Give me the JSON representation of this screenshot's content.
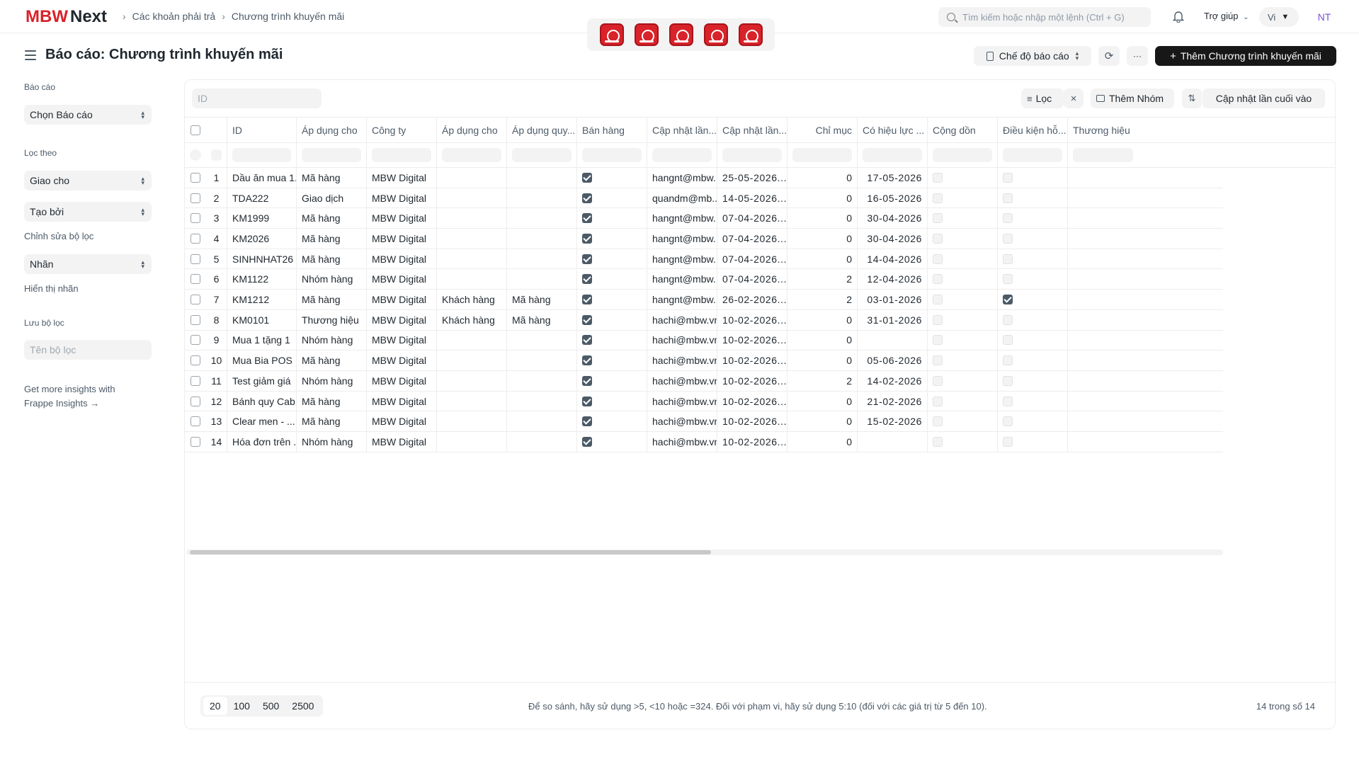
{
  "navbar": {
    "logo_mbw": "MBW",
    "logo_next": "Next",
    "breadcrumb": [
      "Các khoản phải trả",
      "Chương trình khuyến mãi"
    ],
    "search_placeholder": "Tìm kiếm hoặc nhập một lệnh (Ctrl + G)",
    "help_label": "Trợ giúp",
    "lang_label": "Vi",
    "avatar_initials": "NT",
    "app_icons": [
      "app-shortcut-1",
      "app-shortcut-2",
      "app-shortcut-3",
      "app-shortcut-4",
      "app-shortcut-5"
    ]
  },
  "page": {
    "title": "Báo cáo: Chương trình khuyến mãi",
    "report_mode_label": "Chế độ báo cáo",
    "more_label": "···",
    "add_label": "Thêm Chương trình khuyến mãi"
  },
  "sidebar": {
    "report_label": "Báo cáo",
    "report_select": "Chọn Báo cáo",
    "filter_by_label": "Lọc theo",
    "assigned_to": "Giao cho",
    "created_by": "Tạo bởi",
    "edit_filters": "Chỉnh sửa bộ lọc",
    "tags": "Nhãn",
    "show_tags": "Hiển thị nhãn",
    "save_filter_label": "Lưu bộ lọc",
    "filter_name_placeholder": "Tên bộ lọc",
    "insights_line1": "Get more insights with",
    "insights_line2": "Frappe Insights →"
  },
  "toolbar": {
    "id_placeholder": "ID",
    "filter_label": "Lọc",
    "group_label": "Thêm Nhóm",
    "sort_label": "Cập nhật lần cuối vào"
  },
  "table": {
    "columns": [
      "ID",
      "Áp dụng cho",
      "Công ty",
      "Áp dụng cho",
      "Áp dụng quy...",
      "Bán hàng",
      "Cập nhật lần...",
      "Cập nhật lần...",
      "Chỉ mục",
      "Có hiệu lực ...",
      "Cộng dồn",
      "Điều kiện hỗ...",
      "Thương hiệu"
    ],
    "rows": [
      {
        "n": "1",
        "id": "Dầu ăn mua 1...",
        "apply_on": "Mã hàng",
        "company": "MBW Digital",
        "applicable_for": "",
        "apply_rule": "",
        "selling": true,
        "modified_by": "hangnt@mbw...",
        "modified": "25-05-2026...",
        "idx": "0",
        "valid_upto": "17-05-2026",
        "mixed": false,
        "cond": false
      },
      {
        "n": "2",
        "id": "TDA222",
        "apply_on": "Giao dịch",
        "company": "MBW Digital",
        "applicable_for": "",
        "apply_rule": "",
        "selling": true,
        "modified_by": "quandm@mb...",
        "modified": "14-05-2026...",
        "idx": "0",
        "valid_upto": "16-05-2026",
        "mixed": false,
        "cond": false
      },
      {
        "n": "3",
        "id": "KM1999",
        "apply_on": "Mã hàng",
        "company": "MBW Digital",
        "applicable_for": "",
        "apply_rule": "",
        "selling": true,
        "modified_by": "hangnt@mbw...",
        "modified": "07-04-2026...",
        "idx": "0",
        "valid_upto": "30-04-2026",
        "mixed": false,
        "cond": false
      },
      {
        "n": "4",
        "id": "KM2026",
        "apply_on": "Mã hàng",
        "company": "MBW Digital",
        "applicable_for": "",
        "apply_rule": "",
        "selling": true,
        "modified_by": "hangnt@mbw...",
        "modified": "07-04-2026...",
        "idx": "0",
        "valid_upto": "30-04-2026",
        "mixed": false,
        "cond": false
      },
      {
        "n": "5",
        "id": "SINHNHAT26",
        "apply_on": "Mã hàng",
        "company": "MBW Digital",
        "applicable_for": "",
        "apply_rule": "",
        "selling": true,
        "modified_by": "hangnt@mbw...",
        "modified": "07-04-2026...",
        "idx": "0",
        "valid_upto": "14-04-2026",
        "mixed": false,
        "cond": false
      },
      {
        "n": "6",
        "id": "KM1122",
        "apply_on": "Nhóm hàng",
        "company": "MBW Digital",
        "applicable_for": "",
        "apply_rule": "",
        "selling": true,
        "modified_by": "hangnt@mbw...",
        "modified": "07-04-2026...",
        "idx": "2",
        "valid_upto": "12-04-2026",
        "mixed": false,
        "cond": false
      },
      {
        "n": "7",
        "id": "KM1212",
        "apply_on": "Mã hàng",
        "company": "MBW Digital",
        "applicable_for": "Khách hàng",
        "apply_rule": "Mã hàng",
        "selling": true,
        "modified_by": "hangnt@mbw...",
        "modified": "26-02-2026...",
        "idx": "2",
        "valid_upto": "03-01-2026",
        "mixed": false,
        "cond": true
      },
      {
        "n": "8",
        "id": "KM0101",
        "apply_on": "Thương hiệu",
        "company": "MBW Digital",
        "applicable_for": "Khách hàng",
        "apply_rule": "Mã hàng",
        "selling": true,
        "modified_by": "hachi@mbw.vn",
        "modified": "10-02-2026...",
        "idx": "0",
        "valid_upto": "31-01-2026",
        "mixed": false,
        "cond": false
      },
      {
        "n": "9",
        "id": "Mua 1 tặng 1",
        "apply_on": "Nhóm hàng",
        "company": "MBW Digital",
        "applicable_for": "",
        "apply_rule": "",
        "selling": true,
        "modified_by": "hachi@mbw.vn",
        "modified": "10-02-2026...",
        "idx": "0",
        "valid_upto": "",
        "mixed": false,
        "cond": false
      },
      {
        "n": "10",
        "id": "Mua Bia POS",
        "apply_on": "Mã hàng",
        "company": "MBW Digital",
        "applicable_for": "",
        "apply_rule": "",
        "selling": true,
        "modified_by": "hachi@mbw.vn",
        "modified": "10-02-2026...",
        "idx": "0",
        "valid_upto": "05-06-2026",
        "mixed": false,
        "cond": false
      },
      {
        "n": "11",
        "id": "Test giảm giá",
        "apply_on": "Nhóm hàng",
        "company": "MBW Digital",
        "applicable_for": "",
        "apply_rule": "",
        "selling": true,
        "modified_by": "hachi@mbw.vn",
        "modified": "10-02-2026...",
        "idx": "2",
        "valid_upto": "14-02-2026",
        "mixed": false,
        "cond": false
      },
      {
        "n": "12",
        "id": "Bánh quy Cab...",
        "apply_on": "Mã hàng",
        "company": "MBW Digital",
        "applicable_for": "",
        "apply_rule": "",
        "selling": true,
        "modified_by": "hachi@mbw.vn",
        "modified": "10-02-2026...",
        "idx": "0",
        "valid_upto": "21-02-2026",
        "mixed": false,
        "cond": false
      },
      {
        "n": "13",
        "id": "Clear men - ...",
        "apply_on": "Mã hàng",
        "company": "MBW Digital",
        "applicable_for": "",
        "apply_rule": "",
        "selling": true,
        "modified_by": "hachi@mbw.vn",
        "modified": "10-02-2026...",
        "idx": "0",
        "valid_upto": "15-02-2026",
        "mixed": false,
        "cond": false
      },
      {
        "n": "14",
        "id": "Hóa đơn trên ...",
        "apply_on": "Nhóm hàng",
        "company": "MBW Digital",
        "applicable_for": "",
        "apply_rule": "",
        "selling": true,
        "modified_by": "hachi@mbw.vn",
        "modified": "10-02-2026...",
        "idx": "0",
        "valid_upto": "",
        "mixed": false,
        "cond": false
      }
    ]
  },
  "footer": {
    "page_sizes": [
      "20",
      "100",
      "500",
      "2500"
    ],
    "active_page_size": "20",
    "hint": "Để so sánh, hãy sử dụng >5, <10 hoặc =324. Đối với phạm vi, hãy sử dụng 5:10 (đối với các giá trị từ 5 đến 10).",
    "count": "14 trong số 14"
  },
  "colors": {
    "brand": "#d8232a",
    "primary_button": "#171717",
    "avatar_text": "#7b4fd6"
  }
}
